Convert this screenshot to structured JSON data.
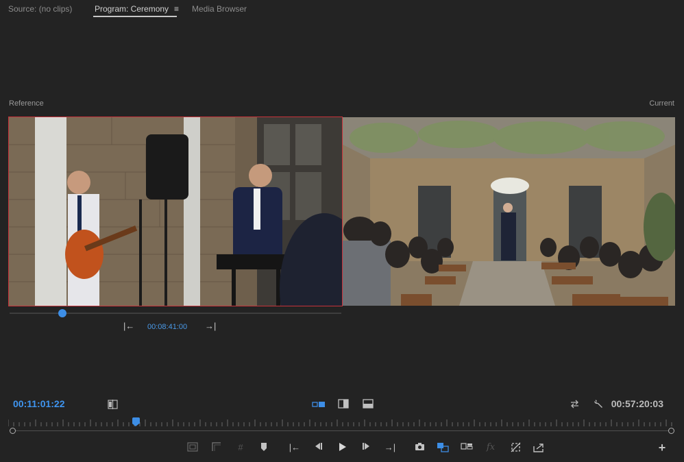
{
  "tabs": {
    "source": "Source: (no clips)",
    "program": "Program: Ceremony",
    "media_browser": "Media Browser"
  },
  "labels": {
    "reference": "Reference",
    "current": "Current"
  },
  "reference": {
    "timecode": "00:08:41:00"
  },
  "program": {
    "playhead_timecode": "00:11:01:22",
    "duration_timecode": "00:57:20:03"
  },
  "icons": {
    "panel_menu": "≡",
    "ref_step_back": "go-to-in-icon",
    "ref_step_forward": "go-to-out-icon",
    "settings": "wrench-icon",
    "add": "plus-icon"
  },
  "colors": {
    "accent_blue": "#3d8ee6",
    "reference_border": "#c8323a"
  }
}
